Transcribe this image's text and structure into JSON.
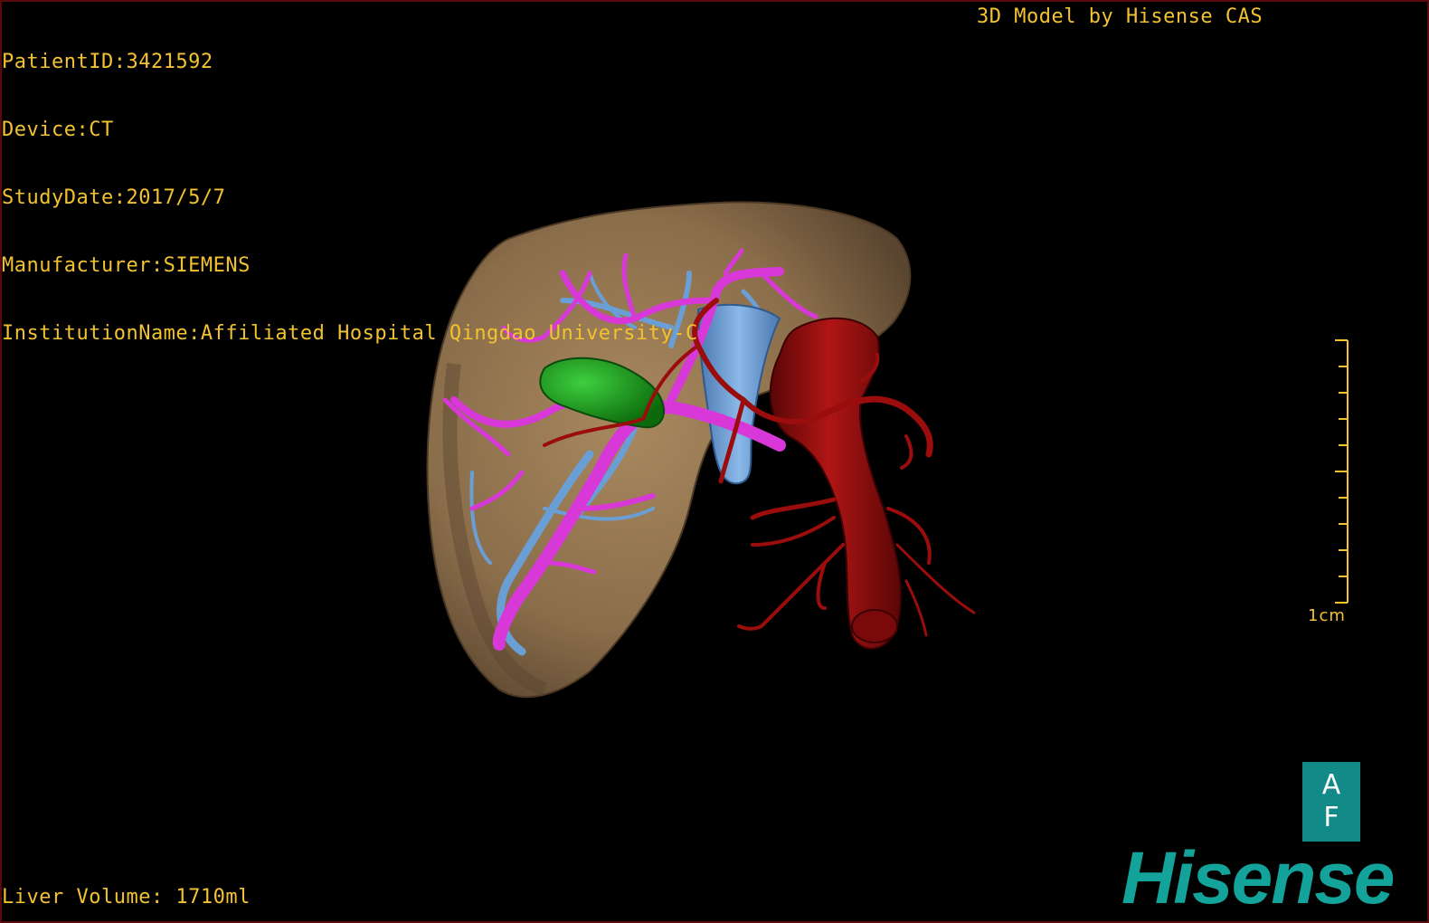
{
  "patient_info": {
    "patient_id": "PatientID:3421592",
    "device": "Device:CT",
    "study_date": "StudyDate:2017/5/7",
    "manufacturer": "Manufacturer:SIEMENS",
    "institution": "InstitutionName:Affiliated Hospital Qingdao University-C"
  },
  "model_credit": "3D Model by Hisense CAS",
  "liver_volume": "Liver Volume: 1710ml",
  "scale_bar": {
    "label": "1cm",
    "color": "#f2c230"
  },
  "orientation_cube": {
    "top_label": "A",
    "bottom_label": "F",
    "color": "#128a88"
  },
  "brand": {
    "name": "Hisense",
    "color": "#13a39a"
  },
  "colors": {
    "overlay_text": "#f2c230",
    "liver": "#8a6d4a",
    "portal_vein": "#d838d8",
    "hepatic_vein": "#6a9fd6",
    "gallbladder": "#1d9a1d",
    "artery": "#9b0d0d"
  }
}
